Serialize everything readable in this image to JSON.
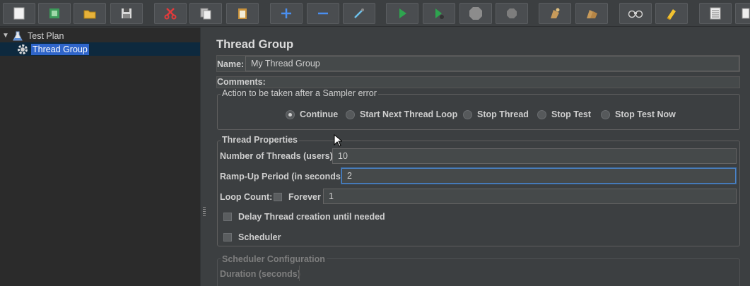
{
  "toolbar": {
    "buttons": [
      {
        "icon": "new-icon"
      },
      {
        "icon": "templates-icon"
      },
      {
        "icon": "open-icon"
      },
      {
        "icon": "save-icon"
      },
      {
        "icon": "cut-icon"
      },
      {
        "icon": "copy-icon"
      },
      {
        "icon": "paste-icon"
      },
      {
        "icon": "expand-icon"
      },
      {
        "icon": "collapse-icon"
      },
      {
        "icon": "toggle-icon"
      },
      {
        "icon": "start-icon"
      },
      {
        "icon": "start-no-pauses-icon"
      },
      {
        "icon": "stop-icon"
      },
      {
        "icon": "shutdown-icon"
      },
      {
        "icon": "clear-icon"
      },
      {
        "icon": "clear-all-icon"
      },
      {
        "icon": "search-icon"
      },
      {
        "icon": "reset-search-icon"
      },
      {
        "icon": "function-helper-icon"
      }
    ]
  },
  "tree": {
    "items": [
      {
        "label": "Test Plan"
      },
      {
        "label": "Thread Group"
      }
    ]
  },
  "panel": {
    "title": "Thread Group",
    "name_label": "Name:",
    "name_value": "My Thread Group",
    "comments_label": "Comments:",
    "sampler_error": {
      "title": "Action to be taken after a Sampler error",
      "options": [
        "Continue",
        "Start Next Thread Loop",
        "Stop Thread",
        "Stop Test",
        "Stop Test Now"
      ],
      "selected": "Continue"
    },
    "thread_properties": {
      "title": "Thread Properties",
      "threads_label": "Number of Threads (users):",
      "threads_value": "10",
      "rampup_label": "Ramp-Up Period (in seconds):",
      "rampup_value": "2",
      "loop_label": "Loop Count:",
      "forever_label": "Forever",
      "loop_value": "1",
      "delay_label": "Delay Thread creation until needed",
      "scheduler_label": "Scheduler"
    },
    "scheduler_config": {
      "title": "Scheduler Configuration",
      "duration_label": "Duration (seconds)"
    }
  },
  "colors": {
    "background": "#3c3f41",
    "tree_background": "#2b2b2b",
    "selection": "#2f65ca",
    "focus_border": "#4c83c7"
  }
}
